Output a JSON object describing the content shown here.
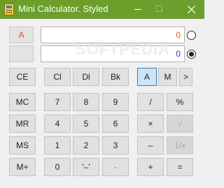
{
  "window": {
    "title": "Mini Calculator. Styled",
    "watermark": "SOFTPEDIA"
  },
  "colors": {
    "titlebar": "#6b9e2b",
    "window_bg": "#f0f0f0",
    "accent_orange": "#d9532a",
    "accent_blue": "#2b3ea8"
  },
  "display": {
    "mode_label": "A",
    "register1_value": "0",
    "register2_value": "0",
    "selected_register": 2
  },
  "buttons": {
    "ce": "CE",
    "cl": "Cl",
    "dl": "Dl",
    "bk": "Bk",
    "mode_a": "A",
    "mode_m": "M",
    "more": ">",
    "mc": "MC",
    "mr": "MR",
    "ms": "MS",
    "mplus": "M+",
    "d7": "7",
    "d8": "8",
    "d9": "9",
    "d4": "4",
    "d5": "5",
    "d6": "6",
    "d1": "1",
    "d2": "2",
    "d3": "3",
    "d0": "0",
    "sign": "'–'",
    "dot": "·",
    "divide": "/",
    "percent": "%",
    "multiply": "×",
    "sqrt": "√",
    "minus": "–",
    "reciprocal": "1/x",
    "plus": "+",
    "equals": "="
  },
  "icons": {
    "app": "calculator-icon",
    "minimize": "minimize-icon",
    "maximize": "maximize-icon",
    "close": "close-icon"
  }
}
